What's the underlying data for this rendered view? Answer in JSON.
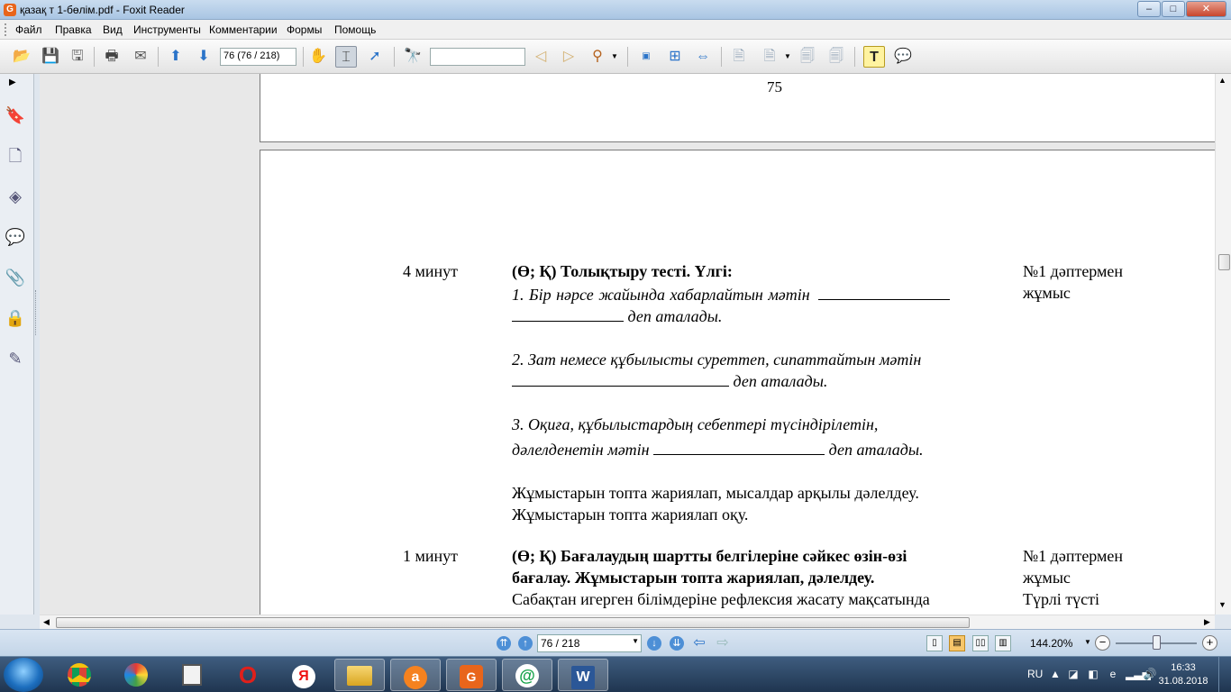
{
  "window": {
    "title": "қазақ т 1-бөлім.pdf - Foxit Reader",
    "app_icon_glyph": "G",
    "controls": {
      "minimize": "–",
      "maximize": "□",
      "close": "✕"
    }
  },
  "menu": {
    "items": [
      "Файл",
      "Правка",
      "Вид",
      "Инструменты",
      "Комментарии",
      "Формы",
      "Помощь"
    ]
  },
  "toolbar": {
    "page_field": "76 (76 / 218)",
    "find_field": ""
  },
  "document": {
    "prev_page_number": "75",
    "row1": {
      "time": "4 минут",
      "heading": "(Ө; Қ) Толықтыру тесті. Үлгі:",
      "q1_a": "1.  Бір  нәрсе  жайында  хабарлайтын  мәтін",
      "q1_b": "деп аталады.",
      "q2_a": "2.  Зат  немесе  құбылысты  суреттеп,  сипаттайтын  мәтін",
      "q2_b": "деп аталады.",
      "q3_a": "3. Оқиға, құбылыстардың себептері түсіндірілетін,",
      "q3_b": "дәлелденетін мәтін",
      "q3_c": "деп аталады.",
      "line1": "Жұмыстарын топта жариялап, мысалдар арқылы дәлелдеу.",
      "line2": "Жұмыстарын топта жариялап оқу.",
      "resource_1": "№1 дәптермен",
      "resource_2": "жұмыс"
    },
    "row2": {
      "time": "1 минут",
      "heading_1": "(Ө; Қ) Бағалаудың шартты белгілеріне сәйкес өзін-өзі",
      "heading_2": "бағалау. Жұмыстарын топта жариялап, дәлелдеу.",
      "line1": "Сабақтан игерген білімдеріне рефлексия жасату мақсатында",
      "resource_1": "№1 дәптермен",
      "resource_2": "жұмыс",
      "resource_3": "Түрлі түсті"
    }
  },
  "statusbar": {
    "page_select": "76 / 218",
    "zoom": "144.20%",
    "zoom_fraction": 0.5
  },
  "taskbar": {
    "language": "RU",
    "time": "16:33",
    "date": "31.08.2018"
  }
}
